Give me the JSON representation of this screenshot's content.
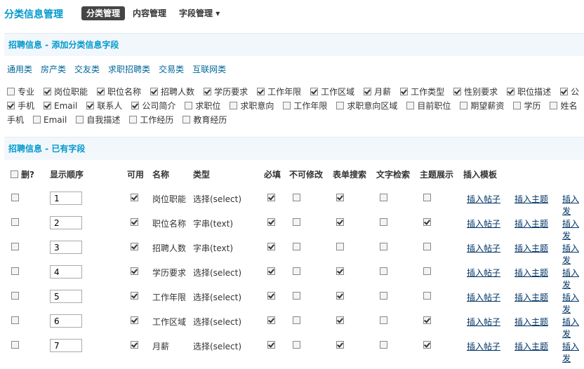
{
  "app_title": "分类信息管理",
  "nav_tabs": [
    {
      "label": "分类管理",
      "active": true
    },
    {
      "label": "内容管理",
      "active": false
    },
    {
      "label": "字段管理 ▾",
      "active": false
    }
  ],
  "add_section_title": "招聘信息 - 添加分类信息字段",
  "category_links": [
    "通用类",
    "房产类",
    "交友类",
    "求职招聘类",
    "交易类",
    "互联网类"
  ],
  "field_rows": [
    [
      {
        "label": "专业",
        "checked": false
      },
      {
        "label": "岗位职能",
        "checked": true
      },
      {
        "label": "职位名称",
        "checked": true
      },
      {
        "label": "招聘人数",
        "checked": true
      },
      {
        "label": "学历要求",
        "checked": true
      },
      {
        "label": "工作年限",
        "checked": true
      },
      {
        "label": "工作区域",
        "checked": true
      },
      {
        "label": "月薪",
        "checked": true
      },
      {
        "label": "工作类型",
        "checked": true
      },
      {
        "label": "性别要求",
        "checked": true
      },
      {
        "label": "职位描述",
        "checked": true
      },
      {
        "label": "公",
        "checked": true
      }
    ],
    [
      {
        "label": "手机",
        "checked": true
      },
      {
        "label": "Email",
        "checked": true
      },
      {
        "label": "联系人",
        "checked": true
      },
      {
        "label": "公司简介",
        "checked": true
      },
      {
        "label": "求职位",
        "checked": false
      },
      {
        "label": "求职意向",
        "checked": false
      },
      {
        "label": "工作年限",
        "checked": false
      },
      {
        "label": "求职意向区域",
        "checked": false
      },
      {
        "label": "目前职位",
        "checked": false
      },
      {
        "label": "期望薪资",
        "checked": false
      },
      {
        "label": "学历",
        "checked": false
      },
      {
        "label": "姓名",
        "checked": false
      }
    ],
    [
      {
        "label": "手机",
        "checked": false,
        "nobox": true
      },
      {
        "label": "Email",
        "checked": false
      },
      {
        "label": "自我描述",
        "checked": false
      },
      {
        "label": "工作经历",
        "checked": false
      },
      {
        "label": "教育经历",
        "checked": false
      }
    ]
  ],
  "existing_section_title": "招聘信息 - 已有字段",
  "table_headers": {
    "delete": "删?",
    "order": "显示顺序",
    "enabled": "可用",
    "name": "名称",
    "type": "类型",
    "required": "必填",
    "readonly": "不可修改",
    "form_search": "表单搜索",
    "text_search": "文字检索",
    "topic_show": "主题展示",
    "insert_template": "插入模板"
  },
  "rows": [
    {
      "order": "1",
      "name": "岗位职能",
      "type": "选择(select)",
      "enabled": true,
      "required": true,
      "readonly": false,
      "form_search": true,
      "text_search": false,
      "topic_show": false
    },
    {
      "order": "2",
      "name": "职位名称",
      "type": "字串(text)",
      "enabled": true,
      "required": true,
      "readonly": false,
      "form_search": true,
      "text_search": false,
      "topic_show": true
    },
    {
      "order": "3",
      "name": "招聘人数",
      "type": "字串(text)",
      "enabled": true,
      "required": true,
      "readonly": false,
      "form_search": false,
      "text_search": false,
      "topic_show": false
    },
    {
      "order": "4",
      "name": "学历要求",
      "type": "选择(select)",
      "enabled": true,
      "required": true,
      "readonly": false,
      "form_search": true,
      "text_search": false,
      "topic_show": false
    },
    {
      "order": "5",
      "name": "工作年限",
      "type": "选择(select)",
      "enabled": true,
      "required": true,
      "readonly": false,
      "form_search": true,
      "text_search": false,
      "topic_show": false
    },
    {
      "order": "6",
      "name": "工作区域",
      "type": "选择(select)",
      "enabled": true,
      "required": true,
      "readonly": false,
      "form_search": true,
      "text_search": false,
      "topic_show": true
    },
    {
      "order": "7",
      "name": "月薪",
      "type": "选择(select)",
      "enabled": true,
      "required": true,
      "readonly": false,
      "form_search": true,
      "text_search": false,
      "topic_show": true
    }
  ],
  "insert_links": [
    "插入帖子",
    "插入主题",
    "插入发"
  ]
}
